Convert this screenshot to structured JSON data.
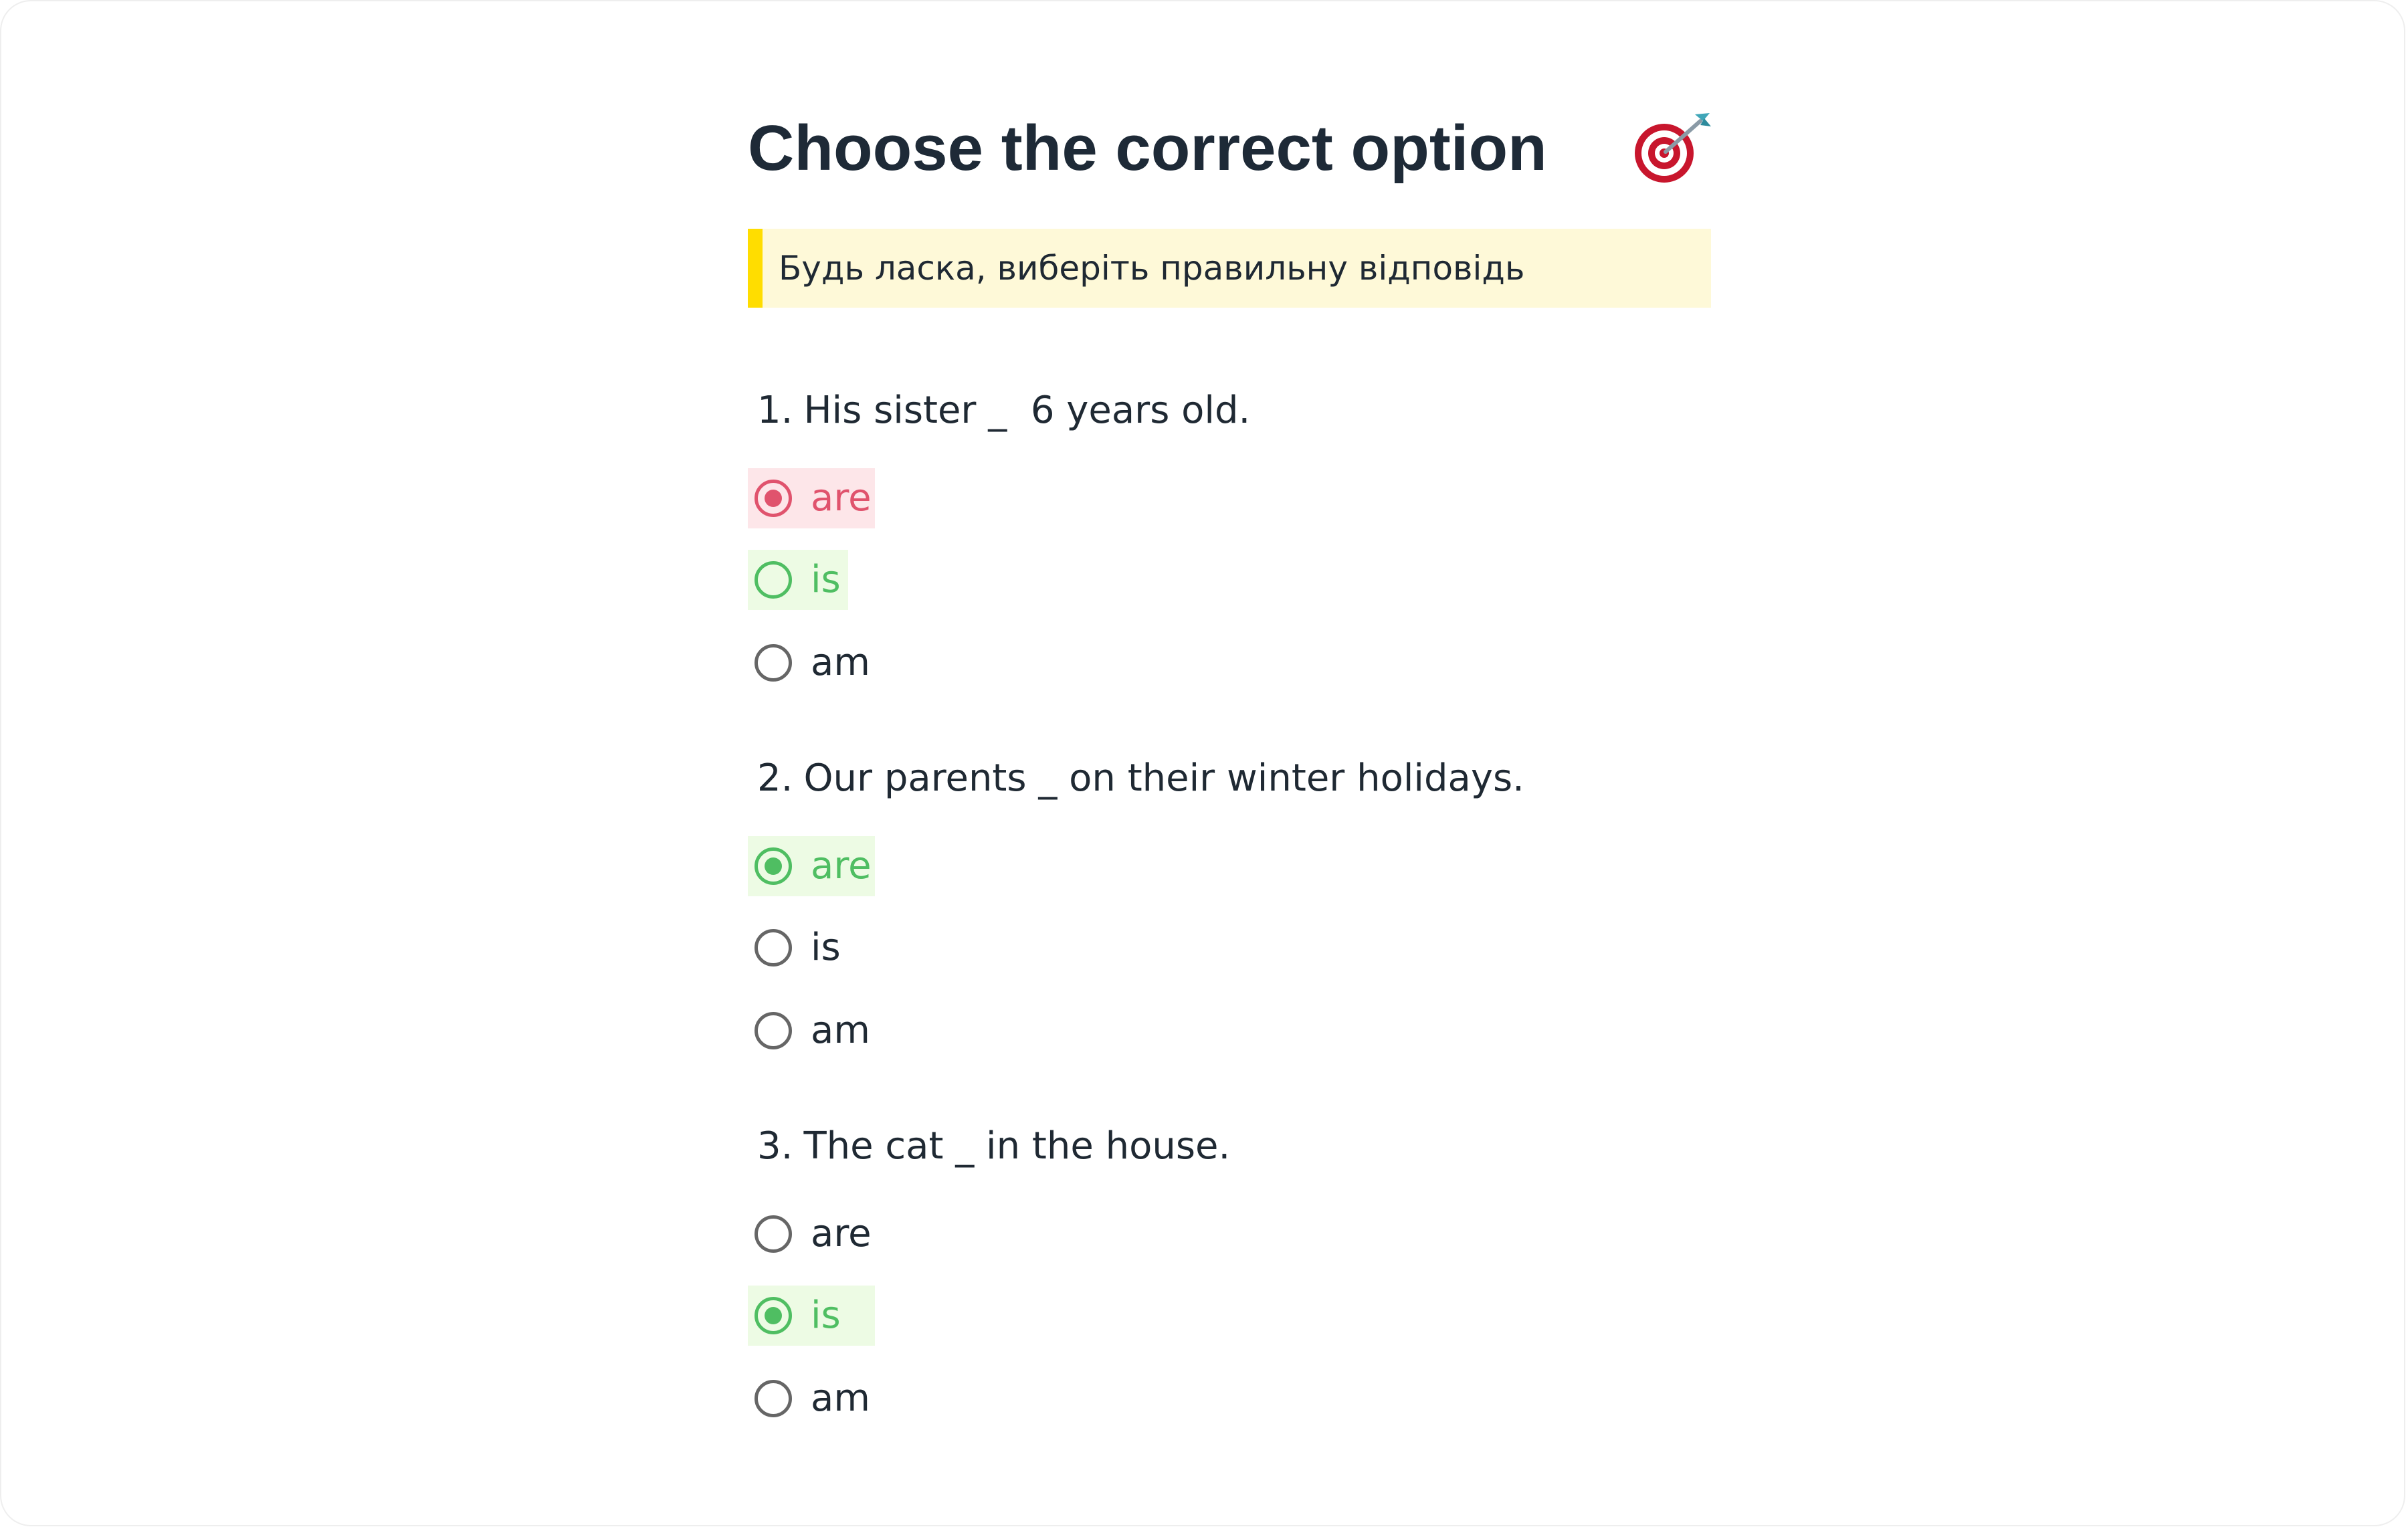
{
  "title": "Choose the correct option",
  "title_icon": "target-dart-icon",
  "instruction": "Будь ласка, виберіть правильну відповідь",
  "colors": {
    "instruction_bg": "#fef9d8",
    "instruction_bar": "#ffdd00",
    "wrong": "#e0536d",
    "wrong_bg": "#fde6e9",
    "correct": "#4fbe62",
    "correct_bg": "#edfbe4",
    "radio_default": "#666666",
    "text": "#1f2933"
  },
  "questions": [
    {
      "number": "1.",
      "text": "His sister _  6 years old.",
      "options": [
        {
          "label": "are",
          "selected": true,
          "state": "wrong"
        },
        {
          "label": "is",
          "selected": false,
          "state": "correct"
        },
        {
          "label": "am",
          "selected": false,
          "state": "neutral"
        }
      ]
    },
    {
      "number": "2.",
      "text": "Our parents _ on their winter holidays.",
      "options": [
        {
          "label": "are",
          "selected": true,
          "state": "correct"
        },
        {
          "label": "is",
          "selected": false,
          "state": "neutral"
        },
        {
          "label": "am",
          "selected": false,
          "state": "neutral"
        }
      ]
    },
    {
      "number": "3.",
      "text": "The cat _ in the house.",
      "options": [
        {
          "label": "are",
          "selected": false,
          "state": "neutral"
        },
        {
          "label": "is",
          "selected": true,
          "state": "correct"
        },
        {
          "label": "am",
          "selected": false,
          "state": "neutral"
        }
      ]
    }
  ]
}
